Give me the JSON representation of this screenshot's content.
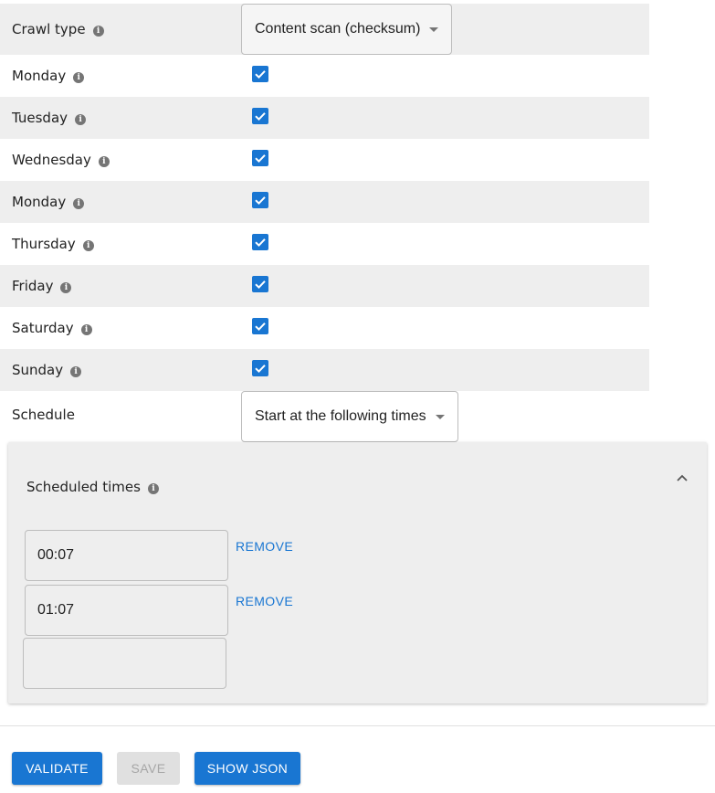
{
  "form": {
    "crawl_type": {
      "label": "Crawl type",
      "value": "Content scan (checksum)"
    },
    "days": [
      {
        "label": "Monday",
        "checked": true
      },
      {
        "label": "Tuesday",
        "checked": true
      },
      {
        "label": "Wednesday",
        "checked": true
      },
      {
        "label": "Monday",
        "checked": true
      },
      {
        "label": "Thursday",
        "checked": true
      },
      {
        "label": "Friday",
        "checked": true
      },
      {
        "label": "Saturday",
        "checked": true
      },
      {
        "label": "Sunday",
        "checked": true
      }
    ],
    "schedule": {
      "label": "Schedule",
      "value": "Start at the following times"
    }
  },
  "scheduled_times": {
    "title": "Scheduled times",
    "times": [
      {
        "value": "00:07",
        "remove_label": "REMOVE"
      },
      {
        "value": "01:07",
        "remove_label": "REMOVE"
      },
      {
        "value": ""
      }
    ]
  },
  "footer": {
    "validate_label": "VALIDATE",
    "save_label": "SAVE",
    "show_json_label": "SHOW JSON"
  },
  "colors": {
    "accent": "#1976d2",
    "row_shade": "#eeeeee",
    "disabled": "#e0e0e0"
  },
  "icons": [
    "info-icon",
    "check-icon",
    "dropdown-caret-icon",
    "chevron-up-icon"
  ]
}
